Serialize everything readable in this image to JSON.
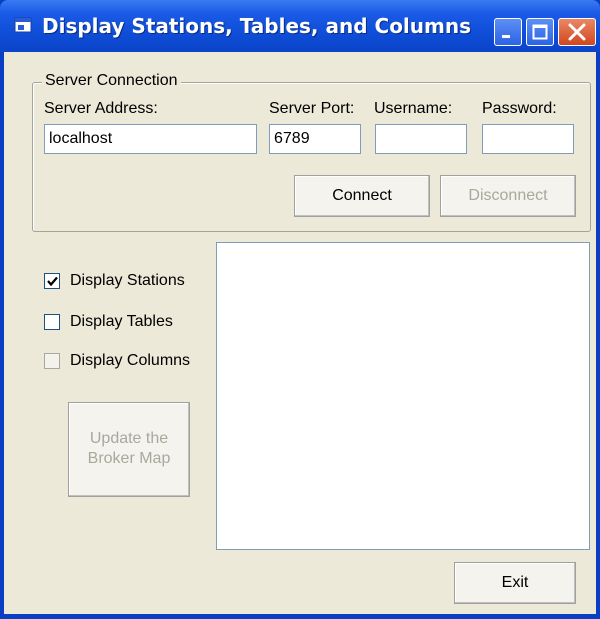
{
  "window": {
    "title": "Display Stations, Tables, and Columns",
    "icon": "app-window-icon",
    "caption_buttons": [
      "minimize-icon",
      "maximize-icon",
      "close-icon"
    ]
  },
  "server_connection": {
    "group_label": "Server Connection",
    "address_label": "Server Address:",
    "address_value": "localhost",
    "port_label": "Server Port:",
    "port_value": "6789",
    "username_label": "Username:",
    "username_value": "",
    "password_label": "Password:",
    "password_value": "",
    "connect_label": "Connect",
    "disconnect_label": "Disconnect"
  },
  "options": {
    "stations_label": "Display Stations",
    "stations_checked": true,
    "tables_label": "Display Tables",
    "tables_checked": false,
    "columns_label": "Display Columns",
    "columns_checked": false,
    "update_line1": "Update the",
    "update_line2": "Broker Map"
  },
  "footer": {
    "exit_label": "Exit"
  },
  "colors": {
    "titlebar": "#0f4fd9",
    "face": "#ece9d8",
    "field_border": "#7f9db9",
    "disabled_text": "#aaa89b"
  }
}
